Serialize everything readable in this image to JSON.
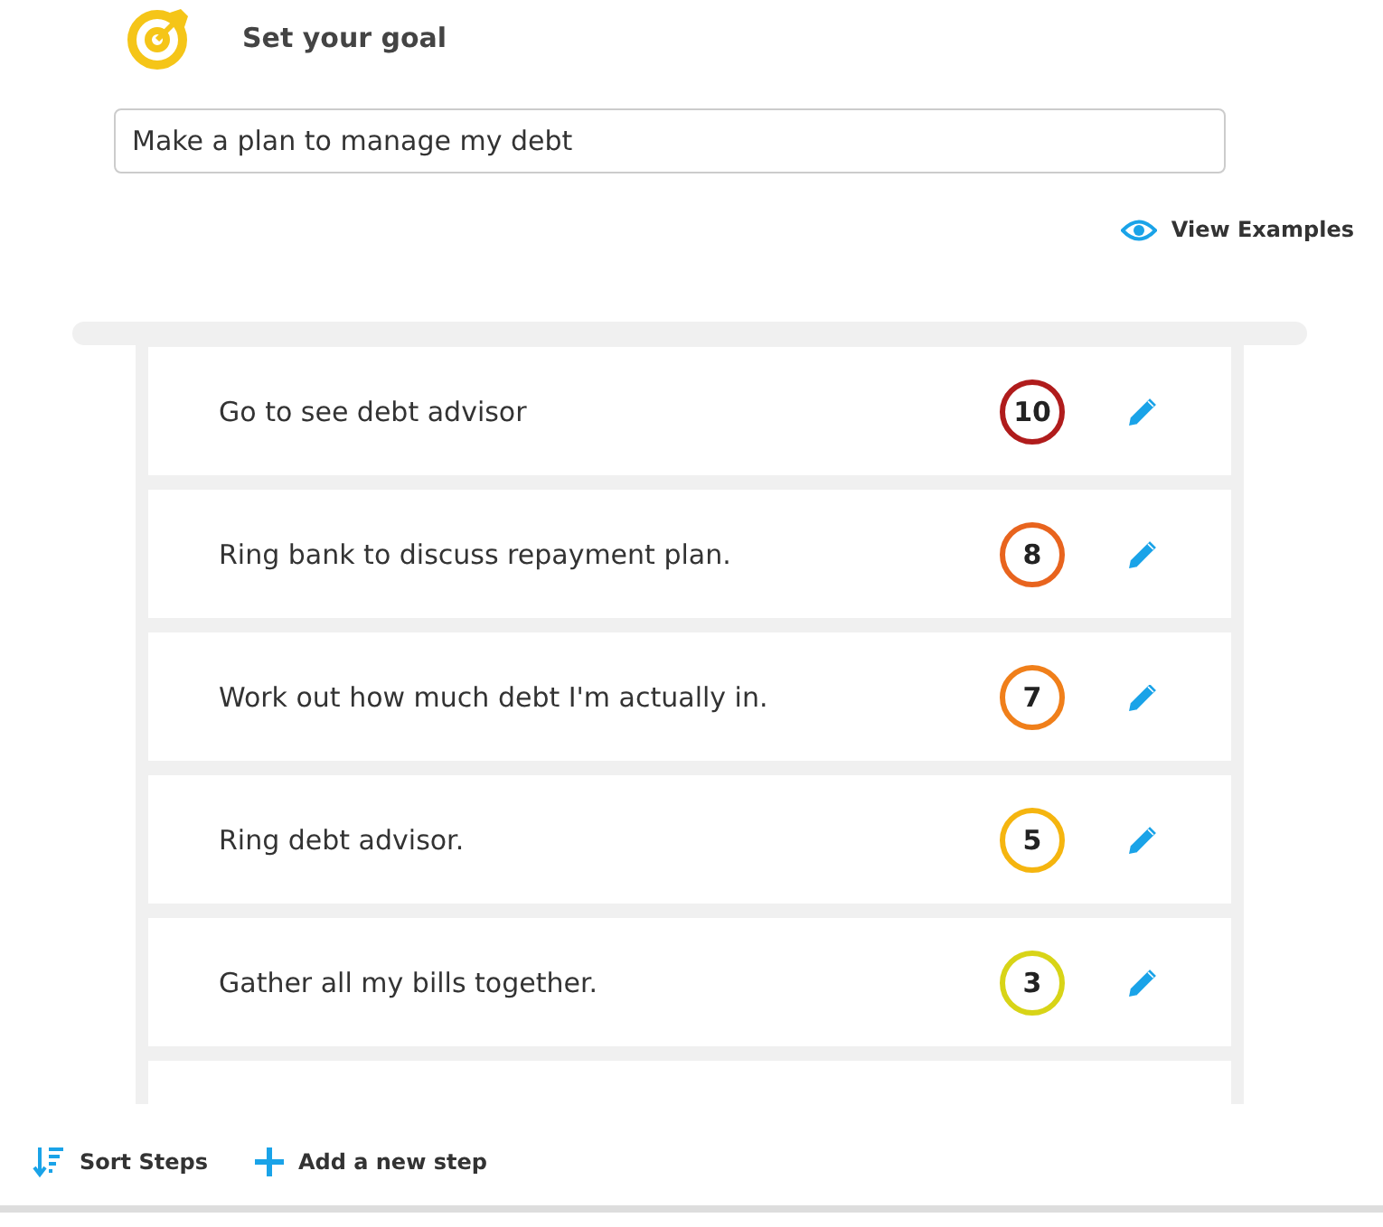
{
  "goal": {
    "title": "Set your goal",
    "value": "Make a plan to manage my debt"
  },
  "view_examples": "View Examples",
  "steps": [
    {
      "text": "Go to see debt advisor",
      "score": "10",
      "color": "#b01c1c"
    },
    {
      "text": "Ring bank to discuss repayment plan.",
      "score": "8",
      "color": "#e8641e"
    },
    {
      "text": "Work out how much debt I'm actually in.",
      "score": "7",
      "color": "#f07f1a"
    },
    {
      "text": "Ring debt advisor.",
      "score": "5",
      "color": "#f5b50f"
    },
    {
      "text": "Gather all my bills together.",
      "score": "3",
      "color": "#d8d417"
    }
  ],
  "footer": {
    "sort": "Sort Steps",
    "add": "Add a new step"
  }
}
